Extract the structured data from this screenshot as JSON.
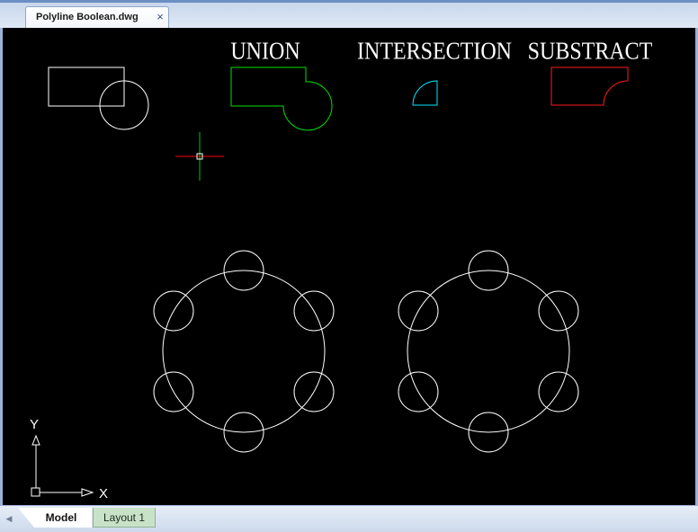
{
  "document": {
    "tab_title": "Polyline Boolean.dwg",
    "close_glyph": "×"
  },
  "canvas": {
    "background": "#000000",
    "labels": {
      "union": "UNION",
      "intersection": "INTERSECTION",
      "subtract": "SUBSTRACT"
    },
    "colors": {
      "source": "#ffffff",
      "union": "#00e000",
      "intersection": "#00e5ff",
      "subtract": "#ff1a1a",
      "crosshair_x": "#ff0000",
      "crosshair_y": "#00c800"
    },
    "ucs": {
      "x_label": "X",
      "y_label": "Y"
    }
  },
  "layout_tabs": [
    {
      "label": "Model",
      "active": true
    },
    {
      "label": "Layout 1",
      "active": false
    }
  ],
  "icons": {
    "tab_close": "close-icon",
    "scroll_left": "chevron-left-icon",
    "ucs": "ucs-axis-icon",
    "cursor": "crosshair-cursor-icon"
  }
}
